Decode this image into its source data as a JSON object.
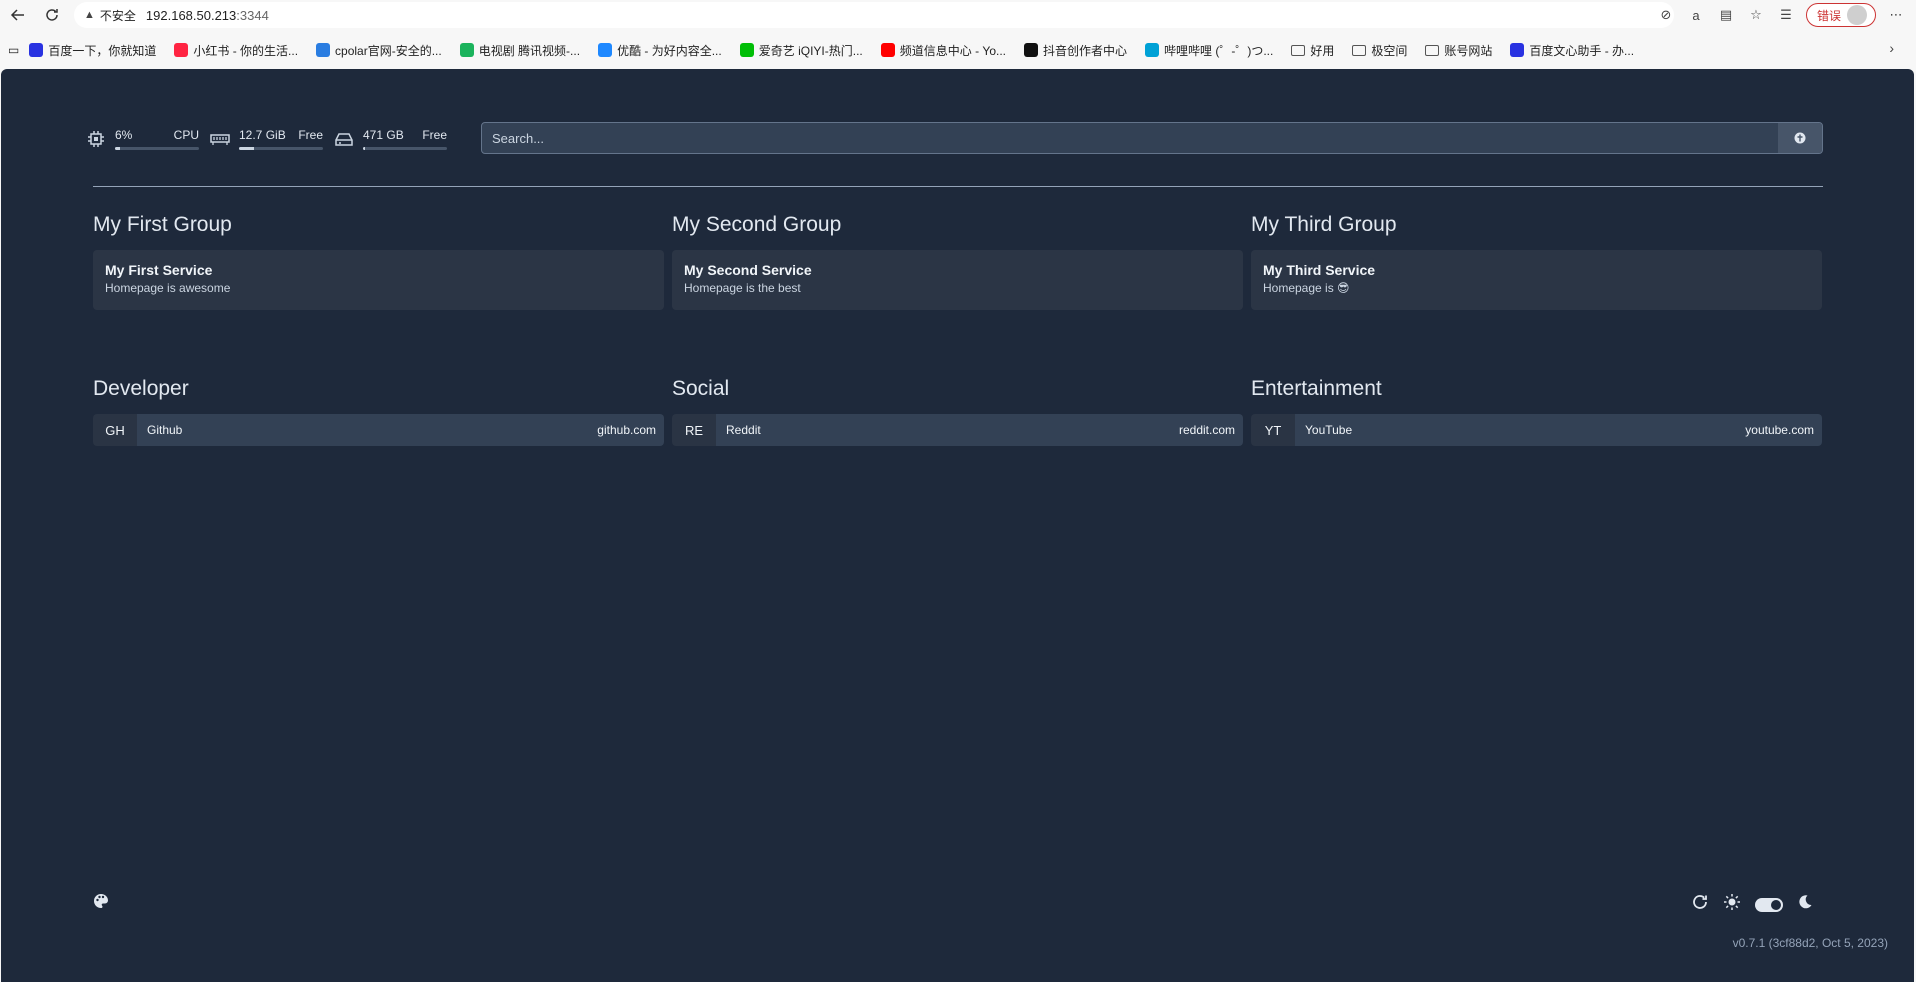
{
  "browser": {
    "security_label": "不安全",
    "url_host": "192.168.50.213",
    "url_port": ":3344",
    "error_label": "错误",
    "bookmarks": [
      {
        "label": "百度一下，你就知道",
        "color": "#2932e1"
      },
      {
        "label": "小红书 - 你的生活...",
        "color": "#ff2442"
      },
      {
        "label": "cpolar官网-安全的...",
        "color": "#2a7de1"
      },
      {
        "label": "电视剧 腾讯视频-...",
        "color": "#1bb35c"
      },
      {
        "label": "优酷 - 为好内容全...",
        "color": "#1e88ff"
      },
      {
        "label": "爱奇艺 iQIYI-热门...",
        "color": "#00be06"
      },
      {
        "label": "频道信息中心 - Yo...",
        "color": "#ff0000"
      },
      {
        "label": "抖音创作者中心",
        "color": "#111111"
      },
      {
        "label": "哔哩哔哩 (゜-゜)つ...",
        "color": "#00a1d6"
      },
      {
        "label": "好用",
        "color": "folder"
      },
      {
        "label": "极空间",
        "color": "folder"
      },
      {
        "label": "账号网站",
        "color": "folder"
      },
      {
        "label": "百度文心助手 - 办...",
        "color": "#2932e1"
      }
    ]
  },
  "widgets": {
    "cpu": {
      "value": "6%",
      "label": "CPU",
      "fraction": 0.06
    },
    "memory": {
      "value": "12.7 GiB",
      "label": "Free",
      "fraction": 0.18
    },
    "disk": {
      "value": "471 GB",
      "label": "Free",
      "fraction": 0.02
    }
  },
  "search": {
    "placeholder": "Search..."
  },
  "service_groups": [
    {
      "title": "My First Group",
      "service": {
        "name": "My First Service",
        "description": "Homepage is awesome"
      }
    },
    {
      "title": "My Second Group",
      "service": {
        "name": "My Second Service",
        "description": "Homepage is the best"
      }
    },
    {
      "title": "My Third Group",
      "service": {
        "name": "My Third Service",
        "description": "Homepage is 😎"
      }
    }
  ],
  "bookmark_groups": [
    {
      "title": "Developer",
      "item": {
        "abbr": "GH",
        "name": "Github",
        "href_label": "github.com"
      }
    },
    {
      "title": "Social",
      "item": {
        "abbr": "RE",
        "name": "Reddit",
        "href_label": "reddit.com"
      }
    },
    {
      "title": "Entertainment",
      "item": {
        "abbr": "YT",
        "name": "YouTube",
        "href_label": "youtube.com"
      }
    }
  ],
  "footer": {
    "version": "v0.7.1 (3cf88d2, Oct 5, 2023)"
  }
}
